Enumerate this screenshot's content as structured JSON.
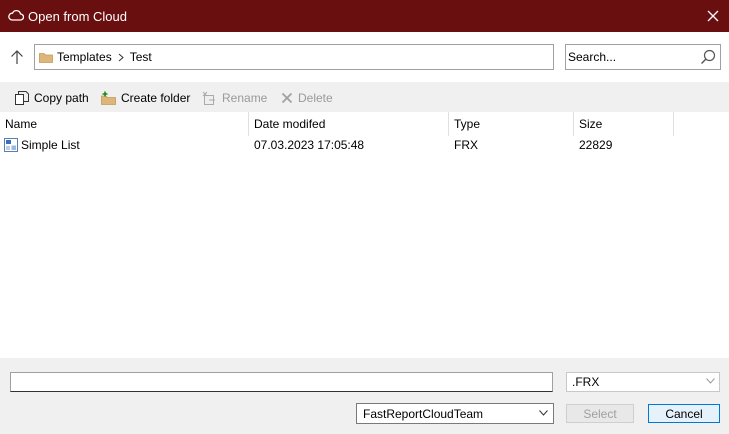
{
  "window": {
    "title": "Open from Cloud"
  },
  "nav": {
    "breadcrumb": [
      "Templates",
      "Test"
    ],
    "search_placeholder": "Search..."
  },
  "toolbar": {
    "copy_path": "Copy path",
    "create_folder": "Create folder",
    "rename": "Rename",
    "delete": "Delete"
  },
  "list": {
    "columns": [
      "Name",
      "Date modifed",
      "Type",
      "Size"
    ],
    "rows": [
      {
        "name": "Simple List",
        "date": "07.03.2023 17:05:48",
        "type": "FRX",
        "size": "22829"
      }
    ]
  },
  "footer": {
    "filename": "",
    "extension": ".FRX",
    "team": "FastReportCloudTeam",
    "select_label": "Select",
    "cancel_label": "Cancel"
  }
}
